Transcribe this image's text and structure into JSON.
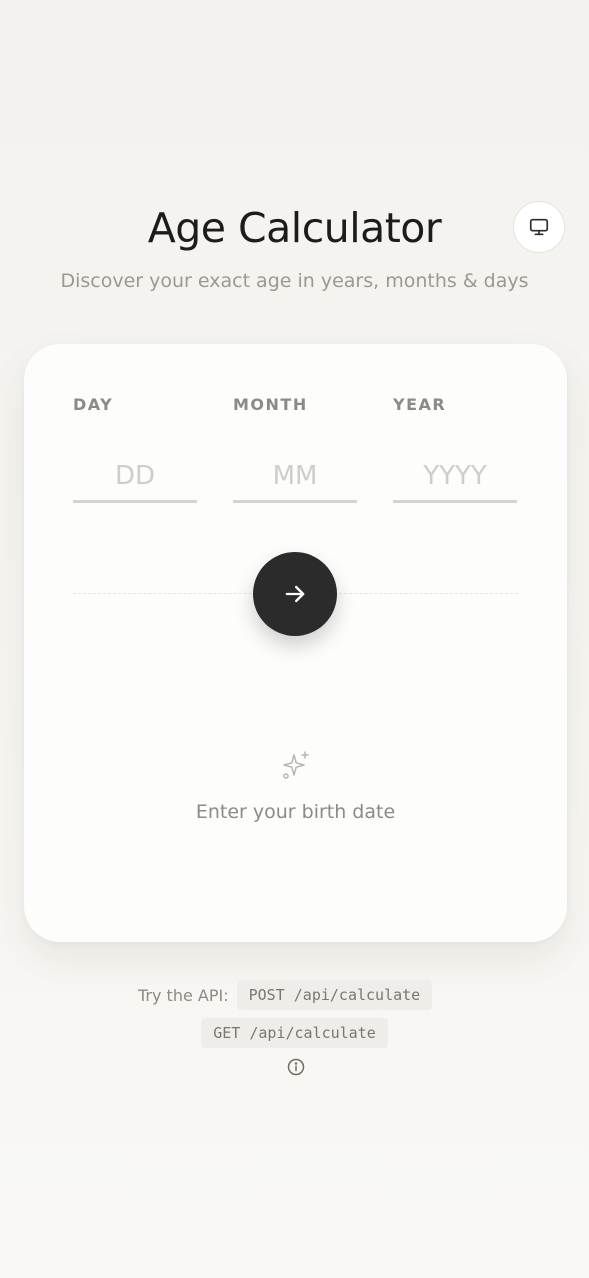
{
  "header": {
    "title": "Age Calculator",
    "subtitle": "Discover your exact age in years, months & days",
    "theme_toggle_icon": "monitor-icon"
  },
  "form": {
    "day": {
      "label": "DAY",
      "placeholder": "DD",
      "value": ""
    },
    "month": {
      "label": "MONTH",
      "placeholder": "MM",
      "value": ""
    },
    "year": {
      "label": "YEAR",
      "placeholder": "YYYY",
      "value": ""
    },
    "submit_icon": "arrow-right-icon"
  },
  "result": {
    "icon": "sparkle-icon",
    "message": "Enter your birth date"
  },
  "api": {
    "label": "Try the API:",
    "post_endpoint": "POST /api/calculate",
    "get_endpoint": "GET /api/calculate",
    "info_icon": "info-icon"
  },
  "colors": {
    "background": "#f6f4f0",
    "card": "#fdfdfb",
    "button": "#2b2b2b",
    "muted_text": "#8d8a86"
  }
}
